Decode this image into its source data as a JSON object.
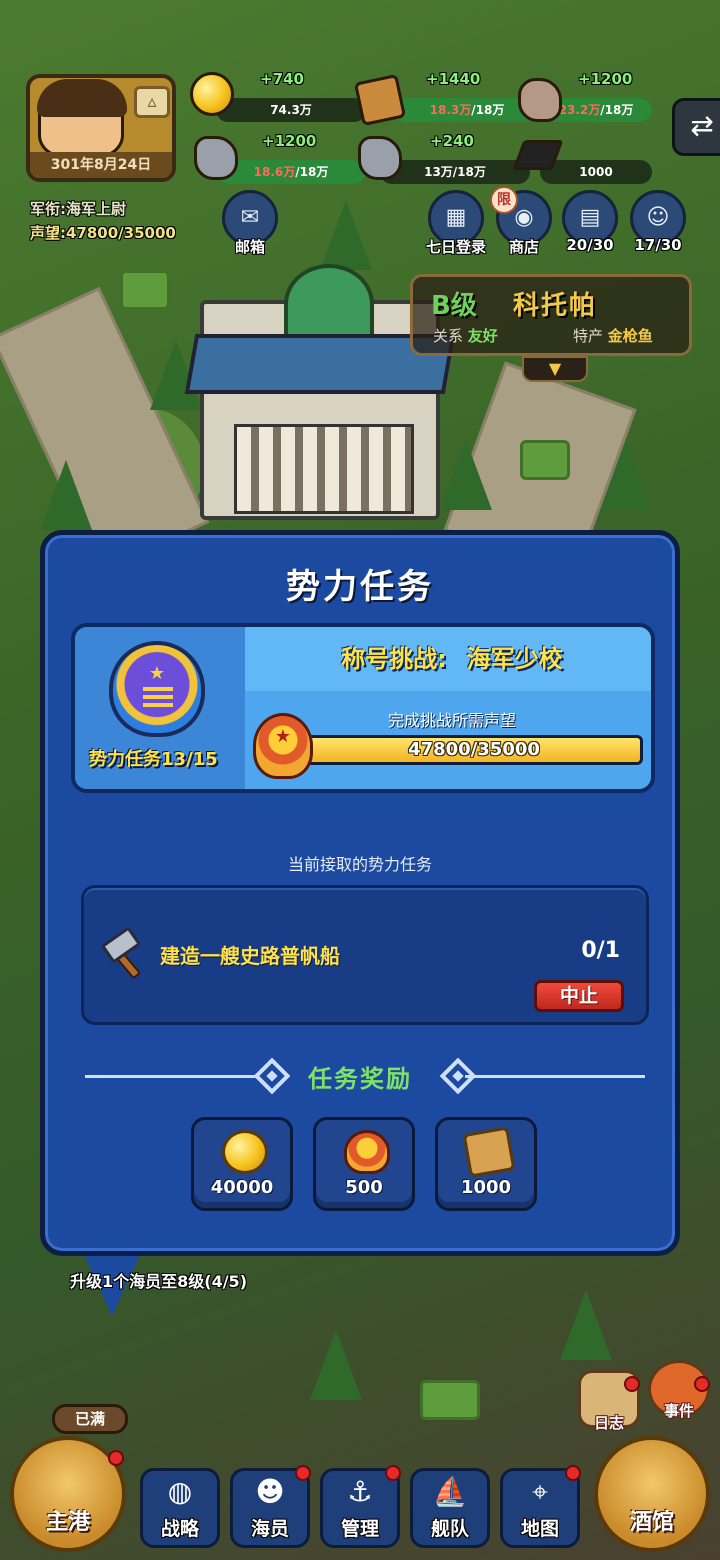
{
  "hud": {
    "date": "301年8月24日",
    "rank": "军衔:海军上尉",
    "reputation": "声望:47800/35000",
    "avatar_up_icon": "triangle-up-icon",
    "resources": {
      "gold": {
        "gain": "+740",
        "value": "74.3万",
        "fill": 0
      },
      "wood": {
        "gain": "+1440",
        "current": "18.3万",
        "cap": "/18万",
        "fill": 1.0
      },
      "ore": {
        "gain": "+1200",
        "current": "23.2万",
        "cap": "/18万",
        "fill": 1.0
      },
      "stone": {
        "gain": "+1200",
        "current": "18.6万",
        "cap": "/18万",
        "fill": 1.0
      },
      "iron": {
        "gain": "+240",
        "value": "13万/18万",
        "fill": 0.72
      },
      "cap": {
        "value": "1000",
        "fill": 0
      }
    },
    "buttons": {
      "mail": "邮箱",
      "seven_day": "七日登录",
      "shop": "商店",
      "shop_badge": "限",
      "books": "20/30",
      "crew": "17/30"
    },
    "exit_icon": "swap-arrows-icon"
  },
  "city": {
    "grade": "B级",
    "name": "科托帕",
    "relation_label": "关系",
    "relation_value": "友好",
    "specialty_label": "特产",
    "specialty_value": "金枪鱼",
    "expand_icon": "chevron-down-icon"
  },
  "modal": {
    "title": "势力任务",
    "challenge_label": "称号挑战:",
    "challenge_target": "海军少校",
    "faction_progress": "势力任务13/15",
    "rep_required_label": "完成挑战所需声望",
    "rep_value": "47800/35000",
    "rep_fill": 1.0,
    "current_label": "当前接取的势力任务",
    "task": {
      "name": "建造一艘史路普帆船",
      "count": "0/1",
      "abort": "中止"
    },
    "reward_title": "任务奖励",
    "rewards": [
      {
        "icon": "gold-coin-icon",
        "value": "40000"
      },
      {
        "icon": "medal-icon",
        "value": "500"
      },
      {
        "icon": "wood-icon",
        "value": "1000"
      }
    ]
  },
  "quest_hint": "升级1个海员至8级(4/5)",
  "side": {
    "log": "日志",
    "event": "事件",
    "full": "已满"
  },
  "nav": {
    "home": "主港",
    "strategy": "战略",
    "crew": "海员",
    "manage": "管理",
    "fleet": "舰队",
    "map": "地图",
    "tavern": "酒馆"
  },
  "colors": {
    "modal_bg": "#1c4aa0",
    "accent_yellow": "#ffe14a",
    "accent_green": "#7fe06a",
    "abort_red": "#e0382a"
  }
}
